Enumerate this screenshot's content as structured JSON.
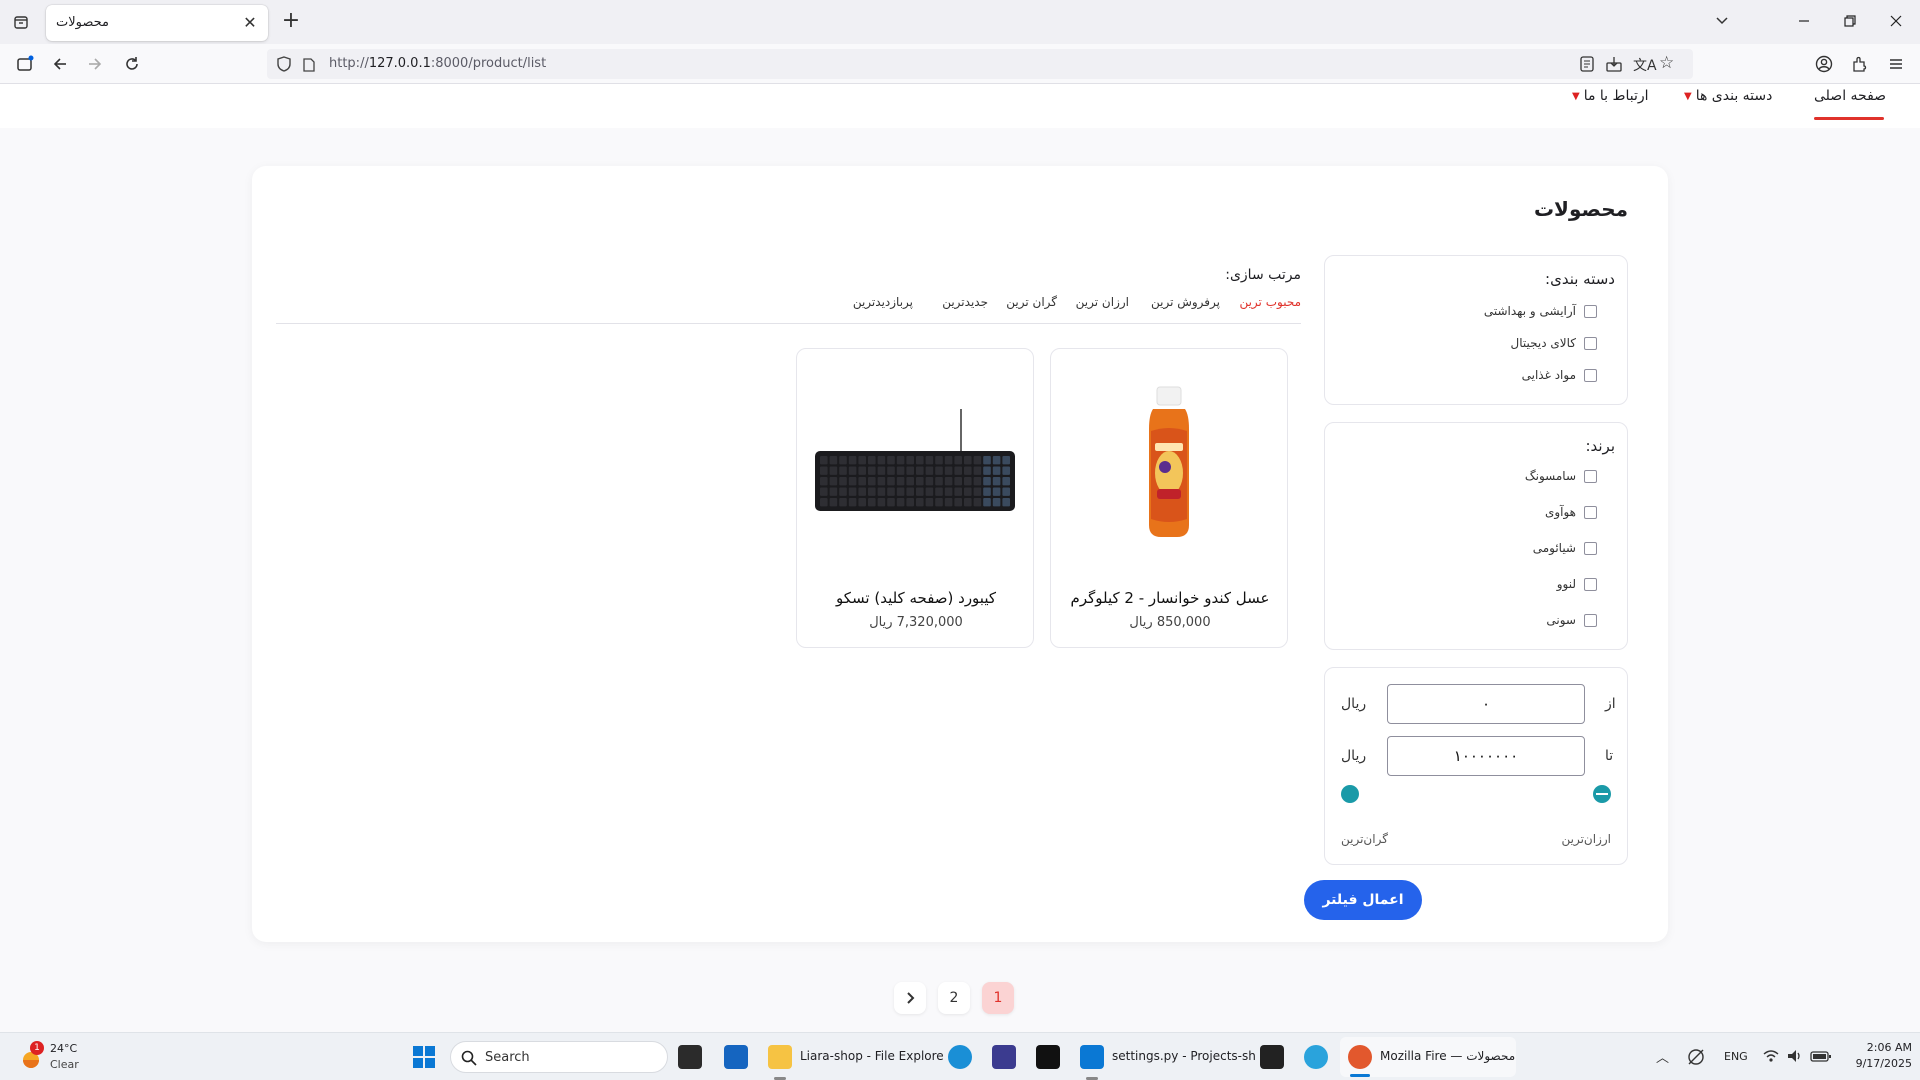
{
  "browser": {
    "tab_title": "محصولات",
    "close_glyph": "✕",
    "newtab_glyph": "+",
    "url_prefix": "http://",
    "url_host": "127.0.0.1",
    "url_rest": ":8000/product/list"
  },
  "site_nav": {
    "items": [
      {
        "label": "صفحه اصلی",
        "active": true
      },
      {
        "label": "دسته بندی ها"
      },
      {
        "label": "ارتباط با ما"
      }
    ],
    "chevron": "▼"
  },
  "page": {
    "title": "محصولات"
  },
  "filters": {
    "category_heading": "دسته بندی:",
    "categories": [
      "آرایشی و بهداشتی",
      "کالای دیجیتال",
      "مواد غذایی"
    ],
    "brand_heading": "برند:",
    "brands": [
      "سامسونگ",
      "هوآوی",
      "شیائومی",
      "لنوو",
      "سونی"
    ],
    "price": {
      "from_label": "از",
      "to_label": "تا",
      "currency": "ریال",
      "from_value": "۰",
      "to_value": "۱۰۰۰۰۰۰۰",
      "cheapest_label": "ارزان‌ترین",
      "priciest_label": "گران‌ترین",
      "accent_color": "#1a9aa8"
    },
    "apply_label": "اعمال فیلتر"
  },
  "sorting": {
    "label": "مرتب سازی:",
    "options": [
      "محبوب ترین",
      "پرفروش ترین",
      "ارزان ترین",
      "گران ترین",
      "جدیدترین",
      "پربازدیدترین"
    ],
    "active_index": 0,
    "active_color": "#e0322b"
  },
  "products": [
    {
      "name": "عسل کندو خوانسار - 2 کیلوگرم",
      "price": "850,000 ریال",
      "image": "honey-bottle"
    },
    {
      "name": "کیبورد (صفحه کلید) تسکو",
      "price": "7,320,000 ریال",
      "image": "keyboard"
    }
  ],
  "pagination": {
    "pages": [
      "1",
      "2"
    ],
    "current": "1",
    "next_glyph": "›"
  },
  "taskbar": {
    "weather_temp": "24°C",
    "weather_desc": "Clear",
    "weather_badge": "1",
    "search_placeholder": "Search",
    "explorer_label": "Liara-shop - File Explore",
    "vscode_label": "settings.py - Projects-sh",
    "firefox_label": "Mozilla Fire — محصولات",
    "lang": "ENG",
    "time": "2:06 AM",
    "date": "9/17/2025"
  }
}
